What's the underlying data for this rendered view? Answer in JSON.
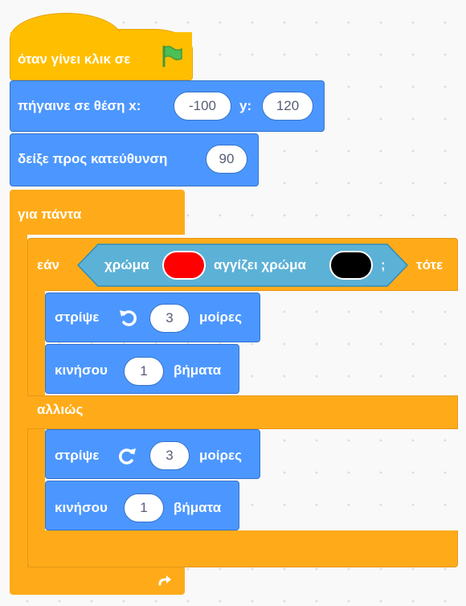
{
  "script": {
    "hat": {
      "label": "όταν γίνει κλικ σε",
      "icon": "green-flag-icon"
    },
    "goto": {
      "label": "πήγαινε σε θέση x:",
      "x": "-100",
      "y_label": "y:",
      "y": "120"
    },
    "point": {
      "label": "δείξε προς κατεύθυνση",
      "value": "90"
    },
    "forever": {
      "label": "για πάντα",
      "loop_icon": "loop-arrow-icon"
    },
    "if_else": {
      "if_label": "εάν",
      "then_label": "τότε",
      "else_label": "αλλιώς",
      "condition": {
        "color_label": "χρώμα",
        "color_value": "#FF0000",
        "touching_label": "αγγίζει χρώμα",
        "touching_value": "#000000",
        "end": ";"
      }
    },
    "if_branch": {
      "turn": {
        "label": "στρίψε",
        "icon": "rotate-left-icon",
        "value": "3",
        "unit": "μοίρες"
      },
      "move": {
        "label": "κινήσου",
        "value": "1",
        "unit": "βήματα"
      }
    },
    "else_branch": {
      "turn": {
        "label": "στρίψε",
        "icon": "rotate-right-icon",
        "value": "3",
        "unit": "μοίρες"
      },
      "move": {
        "label": "κινήσου",
        "value": "1",
        "unit": "βήματα"
      }
    }
  },
  "colors": {
    "events": "#FFBF00",
    "motion": "#4C97FF",
    "control": "#FFAB19",
    "sensing": "#5CB1D6"
  }
}
